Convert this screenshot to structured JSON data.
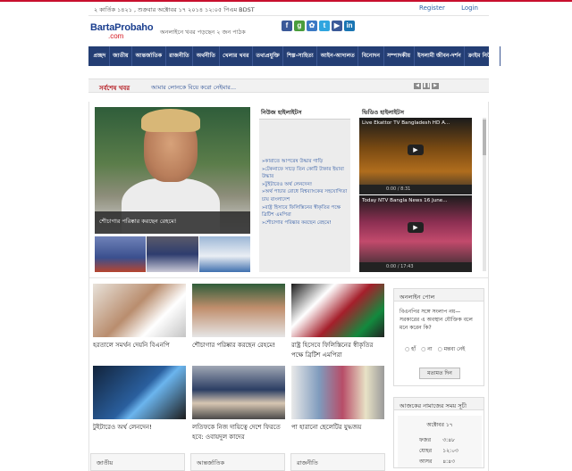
{
  "topbar": {
    "date": "২ কার্তিক ১৪২১ , শুক্রবার অক্টোবর ১৭ ২০১৪ ১২:০৫ পিএম  BDST",
    "register": "Register",
    "login": "Login"
  },
  "header": {
    "logo_main": "BartaProbaho",
    "logo_sub": ".com",
    "tagline": "অনলাইনে খবর পড়ছেন ২ জন পাঠক",
    "social": [
      {
        "icon": "facebook-icon",
        "glyph": "f",
        "color": "#3b5998"
      },
      {
        "icon": "google-plus-icon",
        "glyph": "g",
        "color": "#4a9d3c"
      },
      {
        "icon": "flickr-icon",
        "glyph": "✿",
        "color": "#3b79c4"
      },
      {
        "icon": "twitter-icon",
        "glyph": "t",
        "color": "#2fa5df"
      },
      {
        "icon": "youtube-icon",
        "glyph": "▶",
        "color": "#3b5998"
      },
      {
        "icon": "linkedin-icon",
        "glyph": "in",
        "color": "#1a75b3"
      }
    ]
  },
  "nav": [
    "প্রচ্ছদ",
    "জাতীয়",
    "আন্তর্জাতিক",
    "রাজনীতি",
    "অর্থনীতি",
    "খেলার খবর",
    "তথ্যপ্রযুক্তি",
    "শিল্প-সাহিত্য",
    "আইন-আদালত",
    "বিনোদন",
    "সম্পাদকীয়",
    "ইসলামী জীবন-দর্শন",
    "ক্রাইম নিউজ"
  ],
  "breaking": {
    "label": "সর্বশেষ খবর",
    "text": "আমার লোনকে বিয়ে করো নেইমার..."
  },
  "lead": {
    "caption": "শৌচাগার পরিষ্কার করছেন রেহমে!"
  },
  "news_highlights": {
    "title": "নিউজ হাইলাইটস",
    "items": [
      "»কারাতে আপরেষ উদ্ধার গাড়ি",
      "»টেকনাফে সাড়ে তিন কোটি টাকার ইয়াবা উদ্ধার",
      "»টুইটারেও অর্থ লেনদেন!",
      "»অর্থ পাচার রোধে বিশ্বব্যাংকের সহযোগিতা চায় বাংলাদেশ",
      "»রাষ্ট্র হিসাবে ফিলিস্তিনের স্বীকৃতির পক্ষে ব্রিটিশ এমপিরা",
      "»শৌচাগার পরিষ্কার করছেন রেহমে!"
    ]
  },
  "video_highlights": {
    "title": "ভিডিও হাইলাইটস",
    "videos": [
      {
        "title": "Live Ekattor TV Bangladesh HD A...",
        "time": "0:00 / 8:31"
      },
      {
        "title": "Today NTV Bangla News 16 June...",
        "time": "0:00 / 17:43"
      }
    ]
  },
  "cards": [
    {
      "caption": "হরতালে সমর্থন দেয়নি বিএনপি"
    },
    {
      "caption": "শৌচাগার পরিষ্কার করছেন রেহমে!"
    },
    {
      "caption": "রাষ্ট্র হিসেবে ফিলিস্তিনের স্বীকৃতির পক্ষে ব্রিটিশ এমপিরা"
    },
    {
      "caption": "টুইটারেও অর্থ লেনদেন!"
    },
    {
      "caption": "লতিফকে নিজ দায়িত্বে দেশে ফিরতে হবে: ওবায়দুল কাদের"
    },
    {
      "caption": "পা হারানো ছেলেটির যুদ্ধজয়"
    }
  ],
  "poll": {
    "title": "অনলাইন পোল",
    "question": "বিএনপির সঙ্গে সংলাপ নয়—সরকারের এ অবস্থান যৌক্তিক বলে মনে করেন কি?",
    "options": [
      "হাঁ",
      "না",
      "মন্তব্য নেই"
    ],
    "vote": "মতামত দিন"
  },
  "prayer": {
    "title": "আজকের নামাজের সময় সূচী",
    "day": "অক্টোবর ১৭",
    "rows": [
      {
        "name": "ফজর",
        "time": "৩:৪৮"
      },
      {
        "name": "যোহর",
        "time": "১২:০৩"
      },
      {
        "name": "আসর",
        "time": "৪:৪৩"
      }
    ]
  },
  "sections": [
    "জাতীয়",
    "আন্তর্জাতিক",
    "রাজনীতি"
  ]
}
